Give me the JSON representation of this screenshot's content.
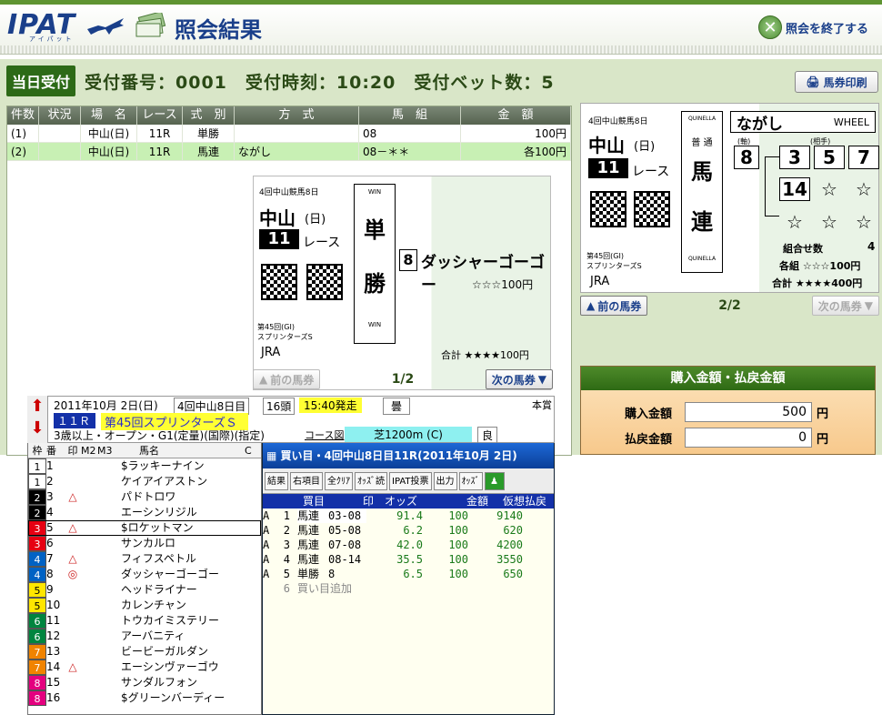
{
  "header": {
    "logo": "IPAT",
    "logo_sub": "アイパット",
    "title": "照会結果",
    "end_label": "照会を終了する"
  },
  "receipt": {
    "badge": "当日受付",
    "info": "受付番号：0001　受付時刻：10:20　受付ベット数：5",
    "print_label": "馬券印刷"
  },
  "table": {
    "headers": [
      "件数",
      "状況",
      "場　名",
      "レース",
      "式　別",
      "方　式",
      "馬　組",
      "金　額"
    ],
    "rows": [
      [
        "(1)",
        "",
        "中山(日)",
        "11R",
        "単勝",
        "",
        "08",
        "100円"
      ],
      [
        "(2)",
        "",
        "中山(日)",
        "11R",
        "馬連",
        "ながし",
        "08－＊＊",
        "各100円"
      ]
    ]
  },
  "ticket1": {
    "meeting": "4回中山競馬8日",
    "venue": "中山",
    "day": "(日)",
    "race_no": "11",
    "race_word": "レース",
    "type_top": "WIN",
    "type_chars": [
      "単",
      "勝"
    ],
    "type_bottom": "WIN",
    "horse_no": "8",
    "horse_name": "ダッシャーゴーゴー",
    "stake": "☆☆☆100円",
    "race_title": "第45回(GI)",
    "race_name": "スプリンターズS",
    "org": "JRA",
    "total": "合計 ★★★★100円",
    "watermark": "JRA",
    "prev": "前の馬券",
    "page": "1/2",
    "next": "次の馬券"
  },
  "ticket2": {
    "meeting": "4回中山競馬8日",
    "venue": "中山",
    "day": "(日)",
    "race_no": "11",
    "race_word": "レース",
    "type_top": "QUINELLA",
    "type_small": "普 通",
    "type_chars": [
      "馬",
      "連"
    ],
    "type_bottom": "QUINELLA",
    "method": "ながし",
    "method_en": "WHEEL",
    "axis_label": "(軸)",
    "partner_label": "(相手)",
    "axis": "8",
    "partners": [
      "3",
      "5",
      "7",
      "14",
      "☆",
      "☆",
      "☆",
      "☆",
      "☆"
    ],
    "combo_label": "組合せ数",
    "combo": "4",
    "each": "各組 ☆☆☆100円",
    "total": "合計 ★★★★400円",
    "race_title": "第45回(GI)",
    "race_name": "スプリンターズS",
    "org": "JRA",
    "prev": "前の馬券",
    "page": "2/2",
    "next": "次の馬券"
  },
  "amounts": {
    "title": "購入金額・払戻金額",
    "buy_label": "購入金額",
    "buy": "500",
    "pay_label": "払戻金額",
    "pay": "0",
    "unit": "円"
  },
  "race": {
    "date": "2011年10月 2日(日)",
    "meet": "4回中山8日目",
    "heads": "16頭",
    "time": "15:40発走",
    "weather": "曇",
    "tag": "本賞",
    "race_no": "１１Ｒ",
    "name": "第45回スプリンターズＳ",
    "cond": "3歳以上・オープン・G1(定量)(国際)(指定)",
    "course_label": "コース図",
    "course": "芝1200m (C)",
    "going": "良"
  },
  "runners": {
    "headers": [
      "枠",
      "番",
      "印",
      "M2",
      "M3",
      "馬名",
      "C"
    ],
    "rows": [
      [
        "1",
        "1",
        "",
        "$ラッキーナイン"
      ],
      [
        "1",
        "2",
        "",
        "ケイアイアストン"
      ],
      [
        "2",
        "3",
        "△",
        "パドトロワ"
      ],
      [
        "2",
        "4",
        "",
        "エーシンリジル"
      ],
      [
        "3",
        "5",
        "△",
        "$ロケットマン"
      ],
      [
        "3",
        "6",
        "",
        "サンカルロ"
      ],
      [
        "4",
        "7",
        "△",
        "フィフスペトル"
      ],
      [
        "4",
        "8",
        "◎",
        "ダッシャーゴーゴー"
      ],
      [
        "5",
        "9",
        "",
        "ヘッドライナー"
      ],
      [
        "5",
        "10",
        "",
        "カレンチャン"
      ],
      [
        "6",
        "11",
        "",
        "トウカイミステリー"
      ],
      [
        "6",
        "12",
        "",
        "アーバニティ"
      ],
      [
        "7",
        "13",
        "",
        "ビービーガルダン"
      ],
      [
        "7",
        "14",
        "△",
        "エーシンヴァーゴウ"
      ],
      [
        "8",
        "15",
        "",
        "サンダルフォン"
      ],
      [
        "8",
        "16",
        "",
        "$グリーンバーディー"
      ]
    ]
  },
  "bets": {
    "title": "買い目・4回中山8日目11R(2011年10月 2日)",
    "tools": [
      "結果",
      "右項目",
      "全ｸﾘｱ",
      "ｵｯｽﾞ読",
      "IPAT投票",
      "出力",
      "ｵｯｽﾞ"
    ],
    "headers": [
      "買目",
      "印",
      "オッズ",
      "金額",
      "仮想払戻"
    ],
    "rows": [
      [
        "A",
        "1",
        "馬連",
        "03-08",
        "91.4",
        "100",
        "9140"
      ],
      [
        "A",
        "2",
        "馬連",
        "05-08",
        "6.2",
        "100",
        "620"
      ],
      [
        "A",
        "3",
        "馬連",
        "07-08",
        "42.0",
        "100",
        "4200"
      ],
      [
        "A",
        "4",
        "馬連",
        "08-14",
        "35.5",
        "100",
        "3550"
      ],
      [
        "A",
        "5",
        "単勝",
        "8",
        "6.5",
        "100",
        "650"
      ]
    ],
    "add": "買い目追加",
    "add_no": "6"
  },
  "colors": {
    "frame": [
      "#ffffff",
      "#000000",
      "#e60012",
      "#0062c4",
      "#ffe600",
      "#00853f",
      "#f08300",
      "#e4007f"
    ]
  }
}
